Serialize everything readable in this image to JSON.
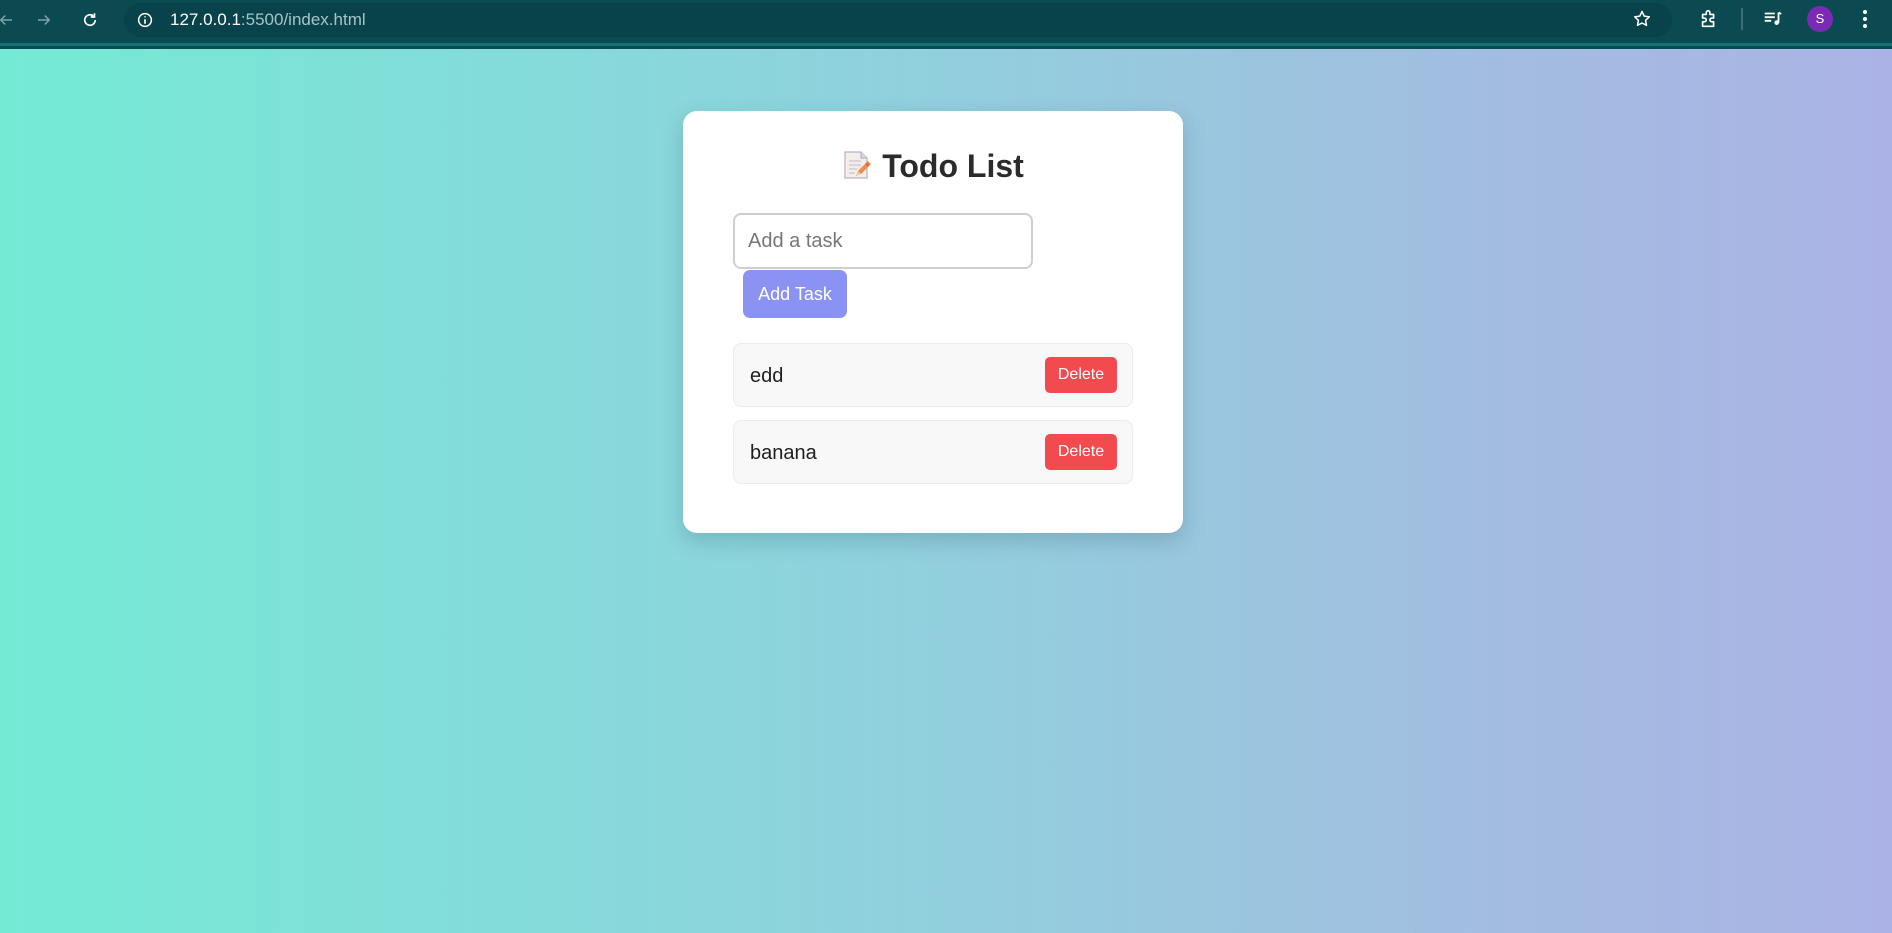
{
  "browser": {
    "url_host": "127.0.0.1",
    "url_path": ":5500/index.html",
    "profile_initial": "S"
  },
  "page": {
    "title": "Todo List",
    "title_icon": "memo-icon",
    "input": {
      "placeholder": "Add a task",
      "value": ""
    },
    "add_button_label": "Add Task",
    "tasks": [
      {
        "text": "edd",
        "delete_label": "Delete"
      },
      {
        "text": "banana",
        "delete_label": "Delete"
      }
    ]
  },
  "colors": {
    "browser_bar": "#0c4a52",
    "gradient_start": "#74ead5",
    "gradient_end": "#abb3e6",
    "add_button": "#8a93f2",
    "delete_button": "#f24b4f",
    "avatar": "#7b2bb3"
  }
}
